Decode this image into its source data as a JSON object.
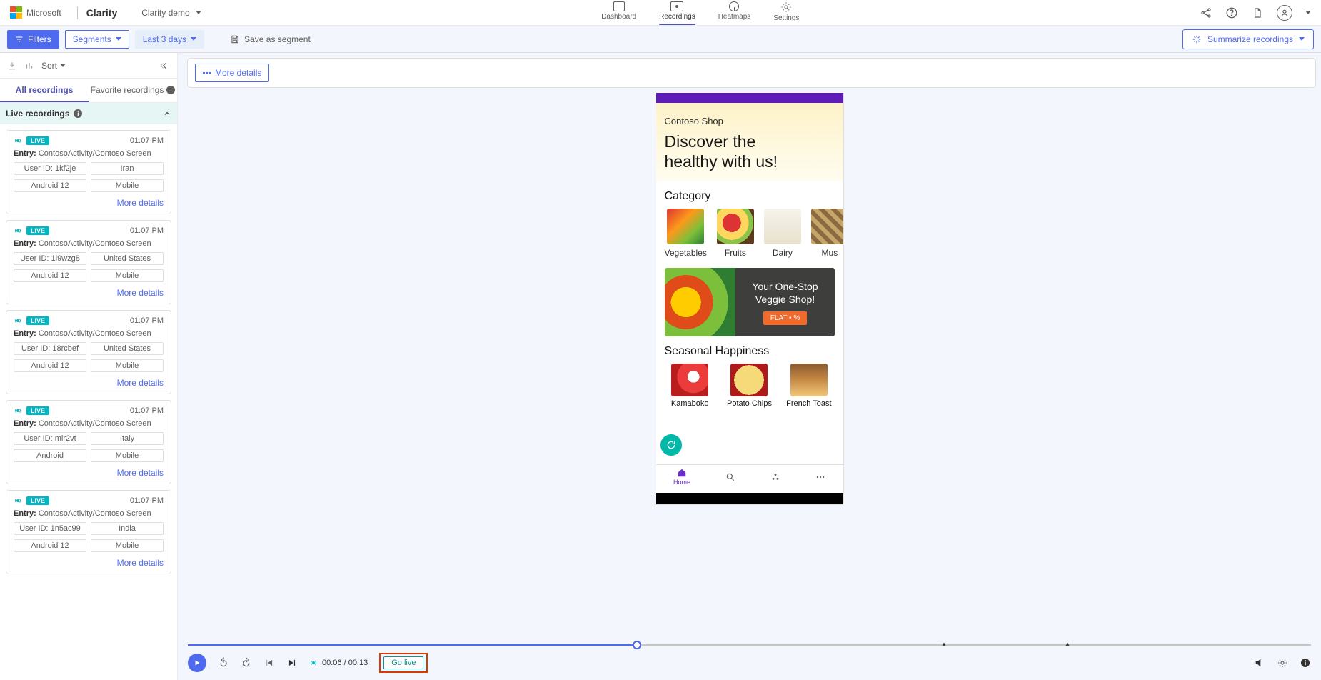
{
  "header": {
    "brand": "Microsoft",
    "product": "Clarity",
    "project": "Clarity demo",
    "nav": [
      {
        "key": "dashboard",
        "label": "Dashboard"
      },
      {
        "key": "recordings",
        "label": "Recordings"
      },
      {
        "key": "heatmaps",
        "label": "Heatmaps"
      },
      {
        "key": "settings",
        "label": "Settings"
      }
    ]
  },
  "filters": {
    "filters_btn": "Filters",
    "segments_btn": "Segments",
    "daterange": "Last 3 days",
    "save_segment": "Save as segment",
    "summarize": "Summarize recordings"
  },
  "left": {
    "sort": "Sort",
    "tabs": {
      "all": "All recordings",
      "fav": "Favorite recordings"
    },
    "live_section": "Live recordings",
    "live_badge": "LIVE",
    "entry_prefix": "Entry:",
    "entry_path": "ContosoActivity/Contoso Screen",
    "more": "More details",
    "cards": [
      {
        "time": "01:07 PM",
        "uid": "User ID: 1kf2je",
        "loc": "Iran",
        "os": "Android 12",
        "dev": "Mobile"
      },
      {
        "time": "01:07 PM",
        "uid": "User ID: 1i9wzg8",
        "loc": "United States",
        "os": "Android 12",
        "dev": "Mobile"
      },
      {
        "time": "01:07 PM",
        "uid": "User ID: 18rcbef",
        "loc": "United States",
        "os": "Android 12",
        "dev": "Mobile"
      },
      {
        "time": "01:07 PM",
        "uid": "User ID: mlr2vt",
        "loc": "Italy",
        "os": "Android",
        "dev": "Mobile"
      },
      {
        "time": "01:07 PM",
        "uid": "User ID: 1n5ac99",
        "loc": "India",
        "os": "Android 12",
        "dev": "Mobile"
      }
    ]
  },
  "main": {
    "more_details": "More details"
  },
  "phone": {
    "shop": "Contoso Shop",
    "headline1": "Discover the",
    "headline2": "healthy with us!",
    "category": "Category",
    "cats": [
      "Vegetables",
      "Fruits",
      "Dairy",
      "Mus"
    ],
    "banner1": "Your One-Stop",
    "banner2": "Veggie Shop!",
    "flat": "FLAT • %",
    "seasonal": "Seasonal Happiness",
    "items": [
      "Kamaboko",
      "Potato Chips",
      "French Toast"
    ],
    "home": "Home"
  },
  "play": {
    "time": "00:06 / 00:13",
    "golive": "Go live"
  }
}
